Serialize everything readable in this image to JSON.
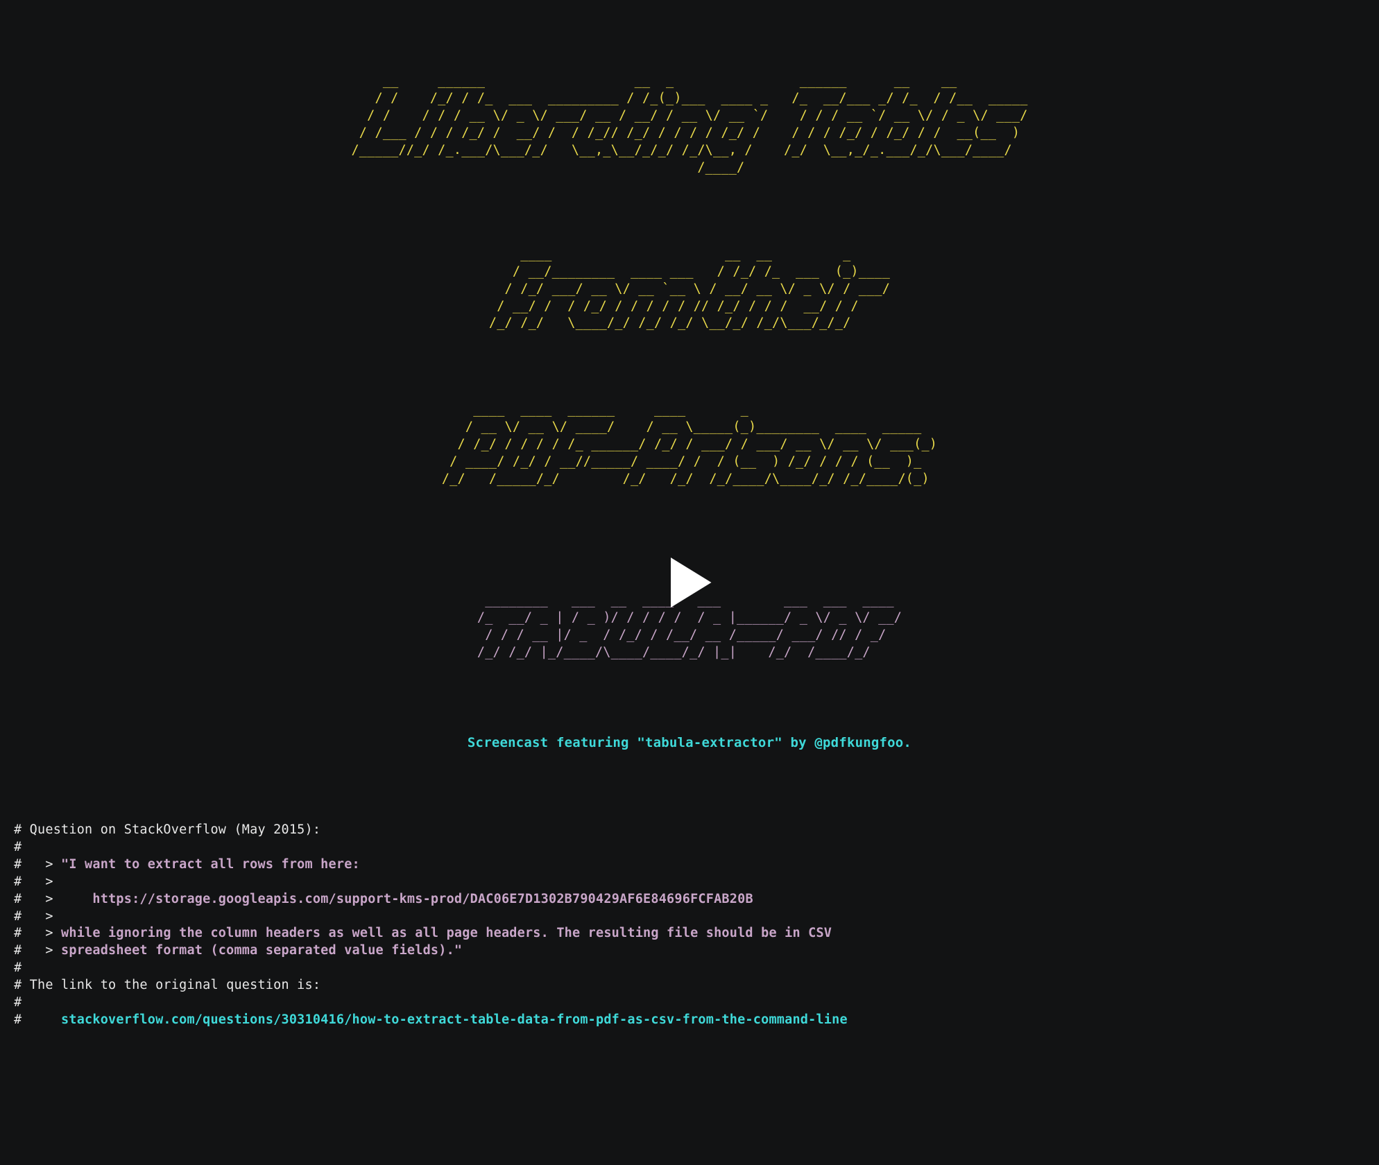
{
  "ascii": {
    "line1_title": "    __     ______                   __  _                ______      __    __         \n   / /    /_/ / /_  ___  _________ / /_(_)___  ____ _   /_  __/___ _/ /_  / /__  _____\n  / /    / / / __ \\/ _ \\/ ___/ __ / __/ / __ \\/ __ `/    / / / __ `/ __ \\/ / _ \\/ ___/\n / /___ / / / /_/ /  __/ /  / /_// /_/ / / / / /_/ /    / / / /_/ / /_/ / /  __(__  ) \n/_____//_/ /_.___/\\___/_/   \\__,_\\__/_/_/ /_/\\__, /    /_/  \\__,_/_.___/_/\\___/____/  \n                                            /____/                                    ",
    "line2_from": "    ____                      __  __         _     \n   / __/________  ____ ___   / /_/ /_  ___  (_)____\n  / /_/ ___/ __ \\/ __ `__ \\ / __/ __ \\/ _ \\/ / ___/\n / __/ /  / /_/ / / / / / // /_/ / / /  __/ / /    \n/_/ /_/   \\____/_/ /_/ /_/ \\__/_/ /_/\\___/_/_/     ",
    "line3_pdf": "    ____  ____  ______     ____       _                      \n   / __ \\/ __ \\/ ____/    / __ \\_____(_)________  ____  _____\n  / /_/ / / / / /_ ______/ /_/ / ___/ / ___/ __ \\/ __ \\/ ___(_)\n / ____/ /_/ / __//_____/ ____/ /  / (__  ) /_/ / / / (__  )_ \n/_/   /_____/_/        /_/   /_/  /_/____/\\____/_/ /_/____/(_)",
    "line4_tabula": " ________   ___  __  ____   ___        ___  ___  ____\n/_  __/ _ | / _ )/ / / / /  / _ |______/ _ \\/ _ \\/ __/\n / / / __ |/ _  / /_/ / /__/ __ /_____/ ___/ // / _/  \n/_/ /_/ |_/____/\\____/____/_/ |_|    /_/  /____/_/    "
  },
  "caption": "Screencast featuring \"tabula-extractor\" by @pdfkungfoo.",
  "body": {
    "heading": "# Question on StackOverflow (May 2015):",
    "hash": "#",
    "q_prefix": "#   > ",
    "q1": "\"I want to extract all rows from here:",
    "url_indent": "#   >     ",
    "url": "https://storage.googleapis.com/support-kms-prod/DAC06E7D1302B790429AF6E84696FCFAB20B",
    "q2a": "while ignoring the column headers as well as all page headers. The resulting file should be in CSV",
    "q2b": "spreadsheet format (comma separated value fields).\"",
    "linkintro": "# The link to the original question is:",
    "link_indent": "#     ",
    "so_link": "stackoverflow.com/questions/30310416/how-to-extract-table-data-from-pdf-as-csv-from-the-command-line"
  }
}
